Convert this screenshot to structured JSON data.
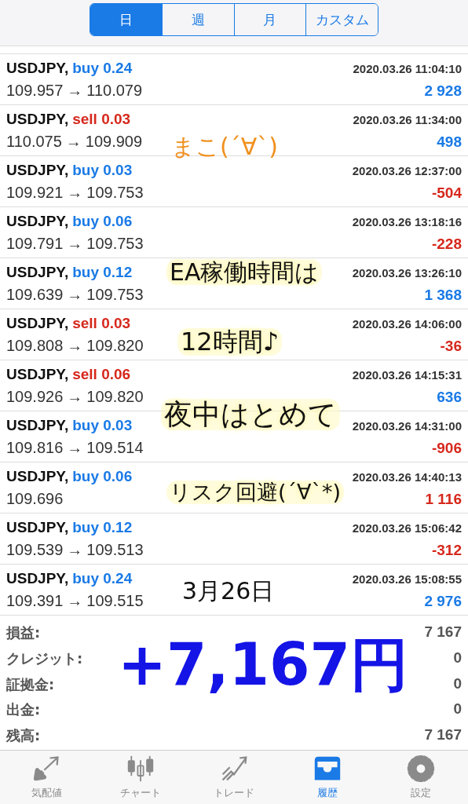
{
  "period_tabs": [
    {
      "label": "日",
      "selected": true
    },
    {
      "label": "週",
      "selected": false
    },
    {
      "label": "月",
      "selected": false
    },
    {
      "label": "カスタム",
      "selected": false
    }
  ],
  "deals": [
    {
      "symbol": "USDJPY,",
      "order": "buy 0.24",
      "kind": "buy",
      "time": "2020.03.26 11:04:10",
      "open": "109.957",
      "arrow": "→",
      "close": "110.079",
      "profit": "2 928",
      "loss": false
    },
    {
      "symbol": "USDJPY,",
      "order": "sell 0.03",
      "kind": "sell",
      "time": "2020.03.26 11:34:00",
      "open": "110.075",
      "arrow": "→",
      "close": "109.909",
      "profit": "498",
      "loss": false
    },
    {
      "symbol": "USDJPY,",
      "order": "buy 0.03",
      "kind": "buy",
      "time": "2020.03.26 12:37:00",
      "open": "109.921",
      "arrow": "→",
      "close": "109.753",
      "profit": "-504",
      "loss": true
    },
    {
      "symbol": "USDJPY,",
      "order": "buy 0.06",
      "kind": "buy",
      "time": "2020.03.26 13:18:16",
      "open": "109.791",
      "arrow": "→",
      "close": "109.753",
      "profit": "-228",
      "loss": true
    },
    {
      "symbol": "USDJPY,",
      "order": "buy 0.12",
      "kind": "buy",
      "time": "2020.03.26 13:26:10",
      "open": "109.639",
      "arrow": "→",
      "close": "109.753",
      "profit": "1 368",
      "loss": false
    },
    {
      "symbol": "USDJPY,",
      "order": "sell 0.03",
      "kind": "sell",
      "time": "2020.03.26 14:06:00",
      "open": "109.808",
      "arrow": "→",
      "close": "109.820",
      "profit": "-36",
      "loss": true
    },
    {
      "symbol": "USDJPY,",
      "order": "sell 0.06",
      "kind": "sell",
      "time": "2020.03.26 14:15:31",
      "open": "109.926",
      "arrow": "→",
      "close": "109.820",
      "profit": "636",
      "loss": false
    },
    {
      "symbol": "USDJPY,",
      "order": "buy 0.03",
      "kind": "buy",
      "time": "2020.03.26 14:31:00",
      "open": "109.816",
      "arrow": "→",
      "close": "109.514",
      "profit": "-906",
      "loss": true
    },
    {
      "symbol": "USDJPY,",
      "order": "buy 0.06",
      "kind": "buy",
      "time": "2020.03.26 14:40:13",
      "open": "109.696",
      "profit": "1 116",
      "loss": true
    },
    {
      "symbol": "USDJPY,",
      "order": "buy 0.12",
      "kind": "buy",
      "time": "2020.03.26 15:06:42",
      "open": "109.539",
      "arrow": "→",
      "close": "109.513",
      "profit": "-312",
      "loss": true
    },
    {
      "symbol": "USDJPY,",
      "order": "buy 0.24",
      "kind": "buy",
      "time": "2020.03.26 15:08:55",
      "open": "109.391",
      "arrow": "→",
      "close": "109.515",
      "profit": "2 976",
      "loss": false
    }
  ],
  "summary": [
    {
      "label": "損益:",
      "value": "7 167"
    },
    {
      "label": "クレジット:",
      "value": "0"
    },
    {
      "label": "証拠金:",
      "value": "0"
    },
    {
      "label": "出金:",
      "value": "0"
    },
    {
      "label": "残高:",
      "value": "7 167"
    }
  ],
  "handwritten_notes": [
    {
      "text": "まこ(´∀`)",
      "color": "#f0901e",
      "highlighted": false
    },
    {
      "text": "EA稼働時間は",
      "color": "#111111",
      "highlighted": true
    },
    {
      "text": "12時間♪",
      "color": "#111111",
      "highlighted": true
    },
    {
      "text": "夜中はとめて",
      "color": "#111111",
      "highlighted": true
    },
    {
      "text": "リスク回避(´∀`*)",
      "color": "#111111",
      "highlighted": true
    },
    {
      "text": "3月26日",
      "color": "#111111",
      "highlighted": false
    },
    {
      "text": "+7,167円",
      "color": "#1414e6",
      "highlighted": false
    }
  ],
  "bottom_tabs": [
    {
      "label": "気配値",
      "selected": false
    },
    {
      "label": "チャート",
      "selected": false
    },
    {
      "label": "トレード",
      "selected": false
    },
    {
      "label": "履歴",
      "selected": true
    },
    {
      "label": "設定",
      "selected": false
    }
  ]
}
